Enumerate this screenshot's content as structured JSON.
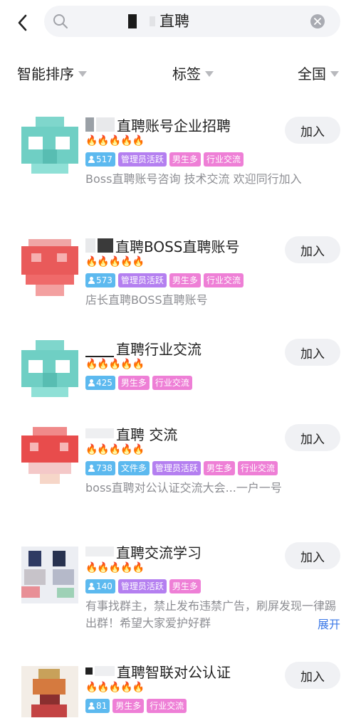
{
  "search": {
    "query": "直聘"
  },
  "filters": {
    "sort": "智能排序",
    "tags": "标签",
    "region": "全国"
  },
  "action_label": "加入",
  "expand_label": "展开",
  "colors": {
    "fire": "#ff6a13",
    "count_tag": "#5cb9ef",
    "admin_tag": "#b47ff0",
    "pink_tag": "#ee7fd6",
    "link": "#3b78e7"
  },
  "groups": [
    {
      "title": "直聘账号企业招聘",
      "fires": "🔥🔥🔥🔥🔥",
      "members": "517",
      "tags": [
        "管理员活跃",
        "男生多",
        "行业交流"
      ],
      "desc": "Boss直聘账号咨询 技术交流 欢迎同行加入"
    },
    {
      "title": "直聘BOSS直聘账号",
      "fires": "🔥🔥🔥🔥🔥",
      "members": "573",
      "tags": [
        "管理员活跃",
        "男生多",
        "行业交流"
      ],
      "desc": "店长直聘BOSS直聘账号"
    },
    {
      "title": "直聘行业交流",
      "fires": "🔥🔥🔥🔥🔥",
      "members": "425",
      "tags": [
        "男生多",
        "行业交流"
      ],
      "desc": ""
    },
    {
      "title": "直聘 交流",
      "fires": "🔥🔥🔥🔥🔥",
      "members": "738",
      "tags": [
        "文件多",
        "管理员活跃",
        "男生多",
        "行业交流"
      ],
      "desc": "boss直聘对公认证交流大会...一户一号"
    },
    {
      "title": "直聘交流学习",
      "fires": "🔥🔥🔥🔥🔥",
      "members": "140",
      "tags": [
        "管理员活跃",
        "男生多"
      ],
      "desc": "有事找群主，禁止发布违禁广告，刷屏发现一律踢出群！希望大家爱护好群"
    },
    {
      "title": "直聘智联对公认证",
      "fires": "🔥🔥🔥🔥🔥",
      "members": "81",
      "tags": [
        "男生多",
        "行业交流"
      ],
      "desc": ""
    }
  ]
}
